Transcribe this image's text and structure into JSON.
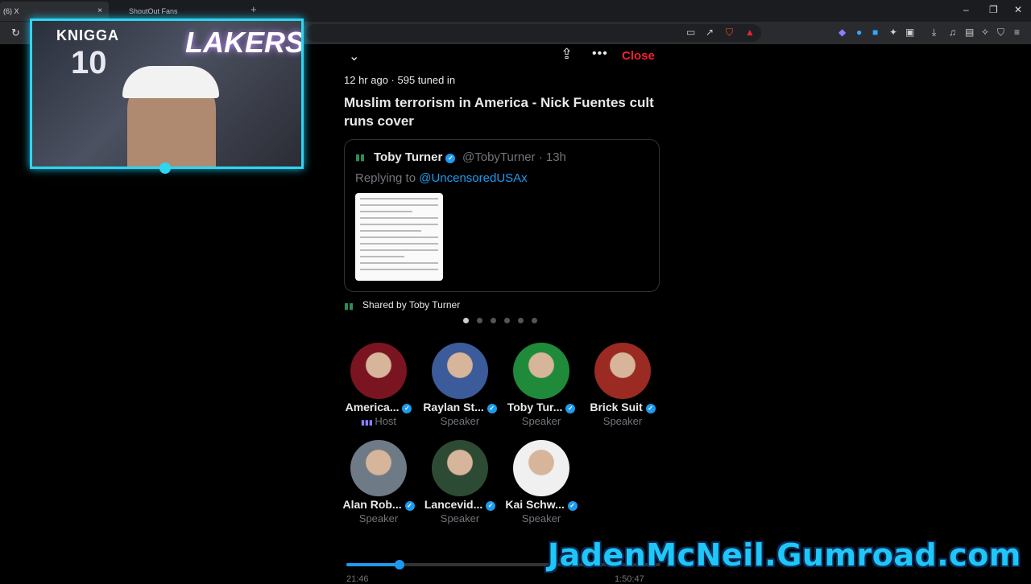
{
  "browser": {
    "tabs": [
      {
        "label": "(6) X",
        "close": "×"
      },
      {
        "label": "ShoutOut Fans"
      }
    ],
    "new_tab": "+",
    "window_controls": [
      "–",
      "❐",
      "✕"
    ]
  },
  "webcam": {
    "jersey_text": "KNIGGA",
    "jersey_number": "10",
    "sign_text": "LAKERS"
  },
  "space": {
    "share_label": "⇪",
    "more_label": "•••",
    "close_label": "Close",
    "meta": "12 hr ago · 595 tuned in",
    "title": "Muslim terrorism in America - Nick Fuentes cult runs cover",
    "tweet": {
      "author": "Toby Turner",
      "handle_time": "@TobyTurner · 13h",
      "replying_prefix": "Replying to ",
      "replying_to": "@UncensoredUSAx"
    },
    "shared_by": "Shared by Toby Turner",
    "carousel_pages": 6,
    "carousel_active": 1,
    "participants": [
      {
        "name": "America...",
        "role": "Host",
        "color": "#7a1420"
      },
      {
        "name": "Raylan St...",
        "role": "Speaker",
        "color": "#3b5b9a"
      },
      {
        "name": "Toby Tur...",
        "role": "Speaker",
        "color": "#1f8a3a"
      },
      {
        "name": "Brick Suit",
        "role": "Speaker",
        "color": "#9a2a22"
      },
      {
        "name": "Alan Rob...",
        "role": "Speaker",
        "color": "#6e7a86"
      },
      {
        "name": "Lancevid...",
        "role": "Speaker",
        "color": "#2d4a35"
      },
      {
        "name": "Kai Schw...",
        "role": "Speaker",
        "color": "#f0f0f0"
      }
    ],
    "playback": {
      "progress": 0.17,
      "elapsed": "21:46",
      "duration": "1:50:47"
    }
  },
  "promo_text": "JadenMcNeil.Gumroad.com",
  "colors": {
    "accent": "#1d9bf0",
    "close_red": "#f4212e",
    "webcam_border": "#30d5f0"
  }
}
